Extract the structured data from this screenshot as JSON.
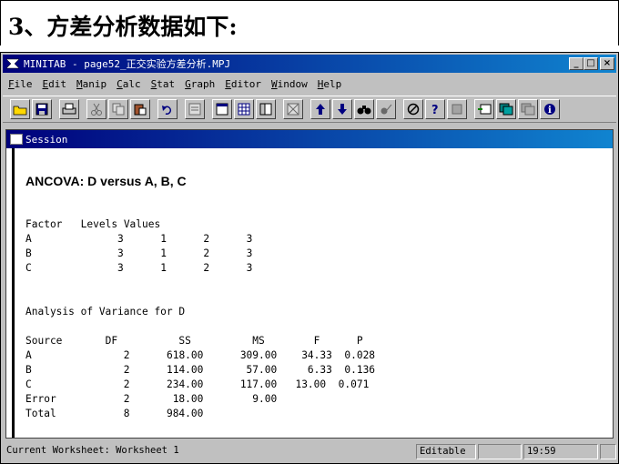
{
  "heading": "3、方差分析数据如下:",
  "window": {
    "title": "MINITAB - page52_正交实验方差分析.MPJ",
    "buttons": {
      "minimize": "_",
      "maximize": "□",
      "close": "×"
    }
  },
  "menu": [
    "File",
    "Edit",
    "Manip",
    "Calc",
    "Stat",
    "Graph",
    "Editor",
    "Window",
    "Help"
  ],
  "toolbar_icons": [
    "open-icon",
    "save-icon",
    "print-icon",
    "cut-icon",
    "copy-icon",
    "paste-icon",
    "undo-icon",
    "edit-last-dialog-icon",
    "session-window-icon",
    "data-window-icon",
    "info-window-icon",
    "history-icon",
    "up-arrow-icon",
    "down-arrow-icon",
    "find-icon",
    "replace-icon",
    "cancel-icon",
    "help-icon",
    "stop-icon",
    "manage-graphs-icon",
    "graph-window-icon",
    "close-graphs-icon",
    "info-icon"
  ],
  "session": {
    "title": "Session",
    "ancova_title": "ANCOVA: D versus A, B, C",
    "factor_header": [
      "Factor",
      "Levels",
      "Values"
    ],
    "factors": [
      {
        "name": "A",
        "levels": "3",
        "values": [
          "1",
          "2",
          "3"
        ]
      },
      {
        "name": "B",
        "levels": "3",
        "values": [
          "1",
          "2",
          "3"
        ]
      },
      {
        "name": "C",
        "levels": "3",
        "values": [
          "1",
          "2",
          "3"
        ]
      }
    ],
    "anova_title": "Analysis of Variance for D",
    "anova_header": [
      "Source",
      "DF",
      "SS",
      "MS",
      "F",
      "P"
    ],
    "anova_rows": [
      [
        "A",
        "2",
        "618.00",
        "309.00",
        "34.33",
        "0.028"
      ],
      [
        "B",
        "2",
        "114.00",
        "57.00",
        "6.33",
        "0.136"
      ],
      [
        "C",
        "2",
        "234.00",
        "117.00",
        "13.00",
        "0.071"
      ],
      [
        "Error",
        "2",
        "18.00",
        "9.00",
        "",
        ""
      ],
      [
        "Total",
        "8",
        "984.00",
        "",
        "",
        ""
      ]
    ]
  },
  "status": {
    "worksheet": "Current Worksheet: Worksheet 1",
    "mode": "Editable",
    "time": "19:59"
  }
}
